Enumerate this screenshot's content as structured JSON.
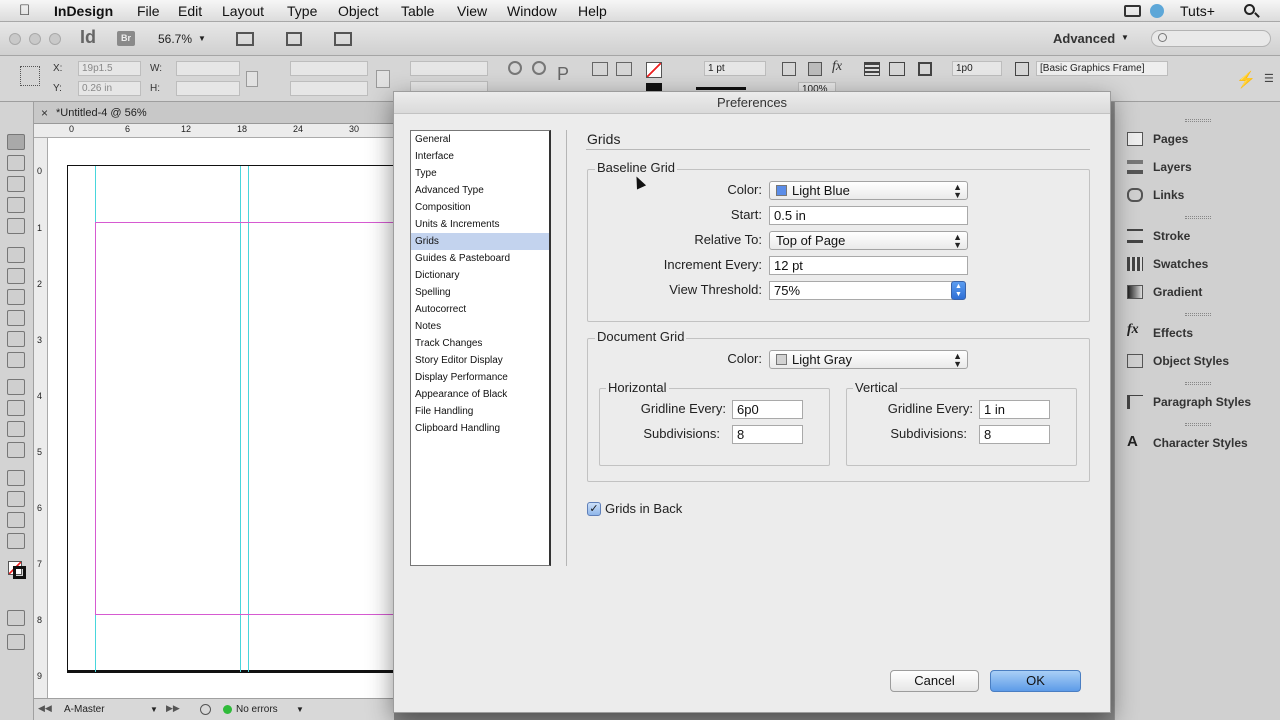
{
  "menubar": {
    "app_name": "InDesign",
    "items": [
      "File",
      "Edit",
      "Layout",
      "Type",
      "Object",
      "Table",
      "View",
      "Window",
      "Help"
    ],
    "right_label": "Tuts+"
  },
  "appbar": {
    "app_icon": "Id",
    "bridge_icon": "Br",
    "zoom": "56.7%",
    "workspace": "Advanced"
  },
  "control_panel": {
    "x_label": "X:",
    "x_value": "19p1.5",
    "y_label": "Y:",
    "y_value": "0.26 in",
    "w_label": "W:",
    "h_label": "H:",
    "stroke_weight": "1 pt",
    "zoom_percent": "100%",
    "offset_value": "1p0",
    "frame_style": "[Basic Graphics Frame]"
  },
  "document": {
    "tab_title": "*Untitled-4 @ 56%",
    "ruler_top": [
      "0",
      "6",
      "12",
      "18",
      "24",
      "30"
    ],
    "ruler_left": [
      "0",
      "1",
      "2",
      "3",
      "4",
      "5",
      "6",
      "7",
      "8",
      "9"
    ],
    "master_page": "A-Master",
    "preflight": "No errors"
  },
  "panels": {
    "items": [
      {
        "label": "Pages",
        "icon": "pages-icon"
      },
      {
        "label": "Layers",
        "icon": "layers-icon"
      },
      {
        "label": "Links",
        "icon": "links-icon"
      },
      {
        "label": "Stroke",
        "icon": "stroke-icon"
      },
      {
        "label": "Swatches",
        "icon": "swatches-icon"
      },
      {
        "label": "Gradient",
        "icon": "gradient-icon"
      },
      {
        "label": "Effects",
        "icon": "effects-icon"
      },
      {
        "label": "Object Styles",
        "icon": "object-styles-icon"
      },
      {
        "label": "Paragraph Styles",
        "icon": "paragraph-styles-icon"
      },
      {
        "label": "Character Styles",
        "icon": "character-styles-icon"
      }
    ]
  },
  "dialog": {
    "title": "Preferences",
    "categories": [
      "General",
      "Interface",
      "Type",
      "Advanced Type",
      "Composition",
      "Units & Increments",
      "Grids",
      "Guides & Pasteboard",
      "Dictionary",
      "Spelling",
      "Autocorrect",
      "Notes",
      "Track Changes",
      "Story Editor Display",
      "Display Performance",
      "Appearance of Black",
      "File Handling",
      "Clipboard Handling"
    ],
    "selected_category": "Grids",
    "section_title": "Grids",
    "baseline_grid": {
      "title": "Baseline Grid",
      "color_label": "Color:",
      "color_value": "Light Blue",
      "color_swatch": "#5b8de8",
      "start_label": "Start:",
      "start_value": "0.5 in",
      "relative_label": "Relative To:",
      "relative_value": "Top of Page",
      "increment_label": "Increment Every:",
      "increment_value": "12 pt",
      "threshold_label": "View Threshold:",
      "threshold_value": "75%"
    },
    "document_grid": {
      "title": "Document Grid",
      "color_label": "Color:",
      "color_value": "Light Gray",
      "color_swatch": "#d2d2d2",
      "horizontal": {
        "title": "Horizontal",
        "gridline_label": "Gridline Every:",
        "gridline_value": "6p0",
        "subdivisions_label": "Subdivisions:",
        "subdivisions_value": "8"
      },
      "vertical": {
        "title": "Vertical",
        "gridline_label": "Gridline Every:",
        "gridline_value": "1 in",
        "subdivisions_label": "Subdivisions:",
        "subdivisions_value": "8"
      }
    },
    "grids_in_back_label": "Grids in Back",
    "grids_in_back_checked": true,
    "cancel_label": "Cancel",
    "ok_label": "OK"
  },
  "colors": {
    "guide_cyan": "#48d6dc",
    "margin_magenta": "#d65ad1",
    "selection": "#c3d3ee"
  }
}
